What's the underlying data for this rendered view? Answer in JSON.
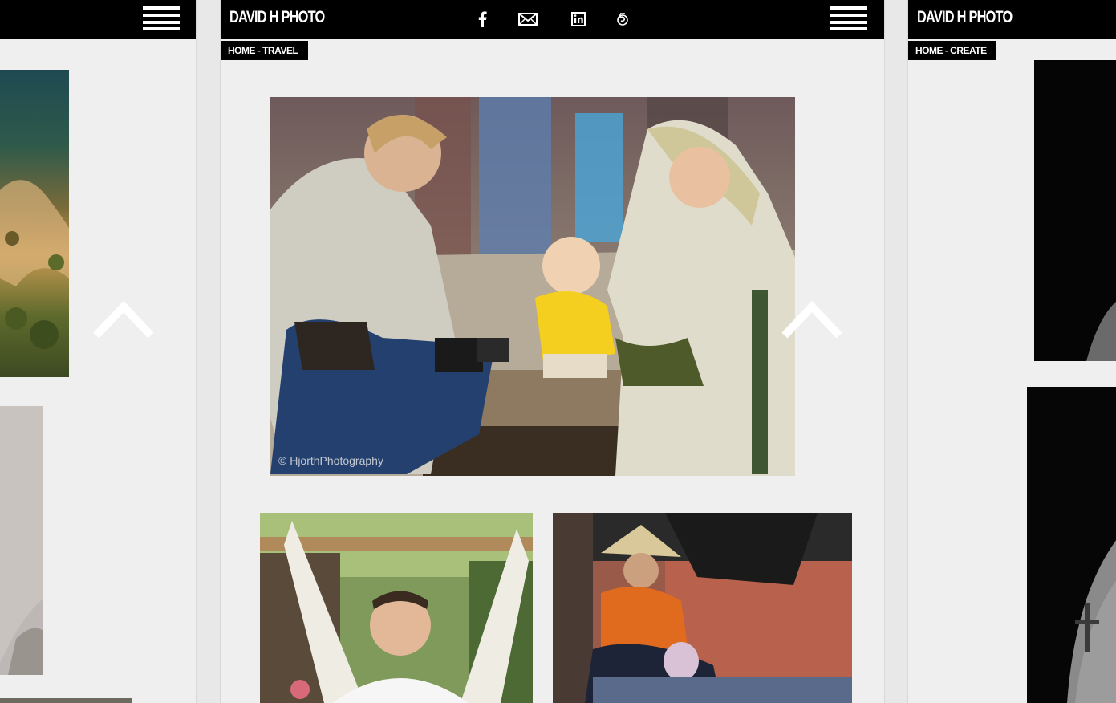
{
  "site": {
    "brand": "DAVID H PHOTO",
    "colors": {
      "bar": "#000000",
      "page": "#efefef",
      "text": "#ffffff"
    }
  },
  "center": {
    "breadcrumb": {
      "home": "HOME",
      "separator": " - ",
      "current": "TRAVEL"
    },
    "social_icons": [
      "facebook-icon",
      "mail-icon",
      "linkedin-icon",
      "500px-icon"
    ],
    "watermark": "© HjorthPhotography"
  },
  "right": {
    "breadcrumb": {
      "home": "HOME",
      "separator": " - ",
      "current": "CREATE"
    }
  }
}
